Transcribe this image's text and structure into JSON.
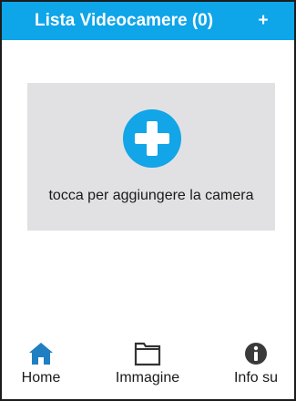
{
  "header": {
    "title": "Lista Videocamere (0)",
    "add_label": "+"
  },
  "empty_state": {
    "message": "tocca per aggiungere la camera"
  },
  "tabbar": {
    "tabs": [
      {
        "label": "Home",
        "icon": "home-icon",
        "active": true
      },
      {
        "label": "Immagine",
        "icon": "folder-icon",
        "active": false
      },
      {
        "label": "Info su",
        "icon": "info-icon",
        "active": false
      }
    ]
  },
  "colors": {
    "header_bg": "#0ea5e9",
    "accent": "#12a5e8",
    "card_bg": "#e1e1e3",
    "icon_dark": "#333333"
  }
}
